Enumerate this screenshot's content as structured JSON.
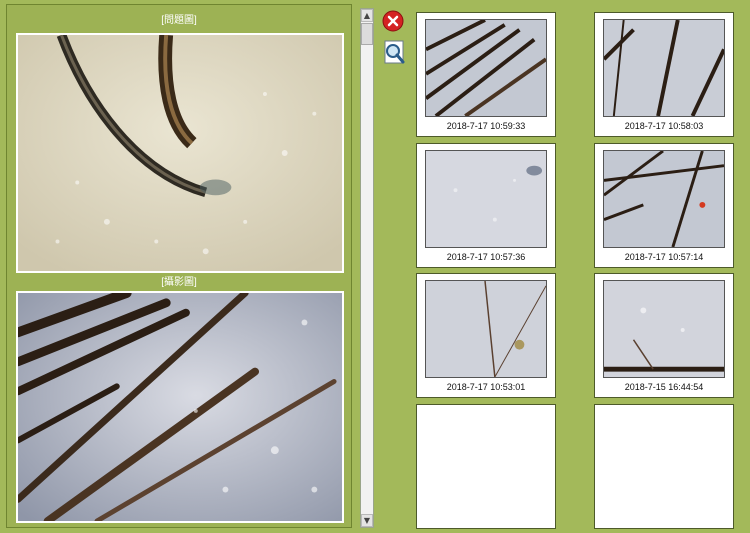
{
  "window": {
    "viewer_top_label": "[問題圖]",
    "viewer_bottom_label": "[攝影圖]"
  },
  "tools": {
    "delete_icon": "close-circle-icon",
    "search_icon": "magnifier-icon"
  },
  "thumbnails": [
    {
      "timestamp": "2018-7-17 10:59:33"
    },
    {
      "timestamp": "2018-7-17 10:58:03"
    },
    {
      "timestamp": "2018-7-17 10:57:36"
    },
    {
      "timestamp": "2018-7-17 10:57:14"
    },
    {
      "timestamp": "2018-7-17 10:53:01"
    },
    {
      "timestamp": "2018-7-15 16:44:54"
    },
    {
      "timestamp": ""
    },
    {
      "timestamp": ""
    }
  ],
  "colors": {
    "background": "#a3b95a",
    "delete": "#d42323"
  }
}
